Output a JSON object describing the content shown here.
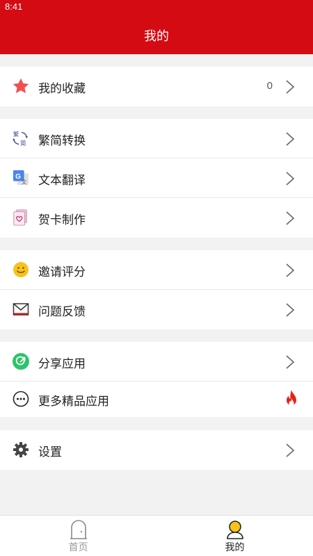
{
  "status": {
    "time": "8:41"
  },
  "header": {
    "title": "我的"
  },
  "groups": [
    {
      "items": [
        {
          "label": "我的收藏",
          "icon": "star-icon",
          "count": "0"
        }
      ]
    },
    {
      "items": [
        {
          "label": "繁简转换",
          "icon": "convert-icon",
          "icon_text_top": "繁",
          "icon_text_bottom": "简"
        },
        {
          "label": "文本翻译",
          "icon": "translate-icon",
          "icon_text_left": "G",
          "icon_text_right": "文"
        },
        {
          "label": "贺卡制作",
          "icon": "card-icon"
        }
      ]
    },
    {
      "items": [
        {
          "label": "邀请评分",
          "icon": "smiley-icon"
        },
        {
          "label": "问题反馈",
          "icon": "mail-icon"
        }
      ]
    },
    {
      "items": [
        {
          "label": "分享应用",
          "icon": "share-icon"
        },
        {
          "label": "更多精品应用",
          "icon": "more-icon",
          "badge_icon": "flame-icon"
        }
      ]
    },
    {
      "items": [
        {
          "label": "设置",
          "icon": "gear-icon"
        }
      ]
    }
  ],
  "tabbar": {
    "tabs": [
      {
        "label": "首页",
        "icon": "home-icon",
        "active": false
      },
      {
        "label": "我的",
        "icon": "profile-icon",
        "active": true
      }
    ],
    "active_color": "#222222",
    "inactive_color": "#999999"
  },
  "colors": {
    "brand_red": "#d40b13",
    "star": "#f25050",
    "smiley": "#f7c21b",
    "share": "#2cc46a"
  }
}
